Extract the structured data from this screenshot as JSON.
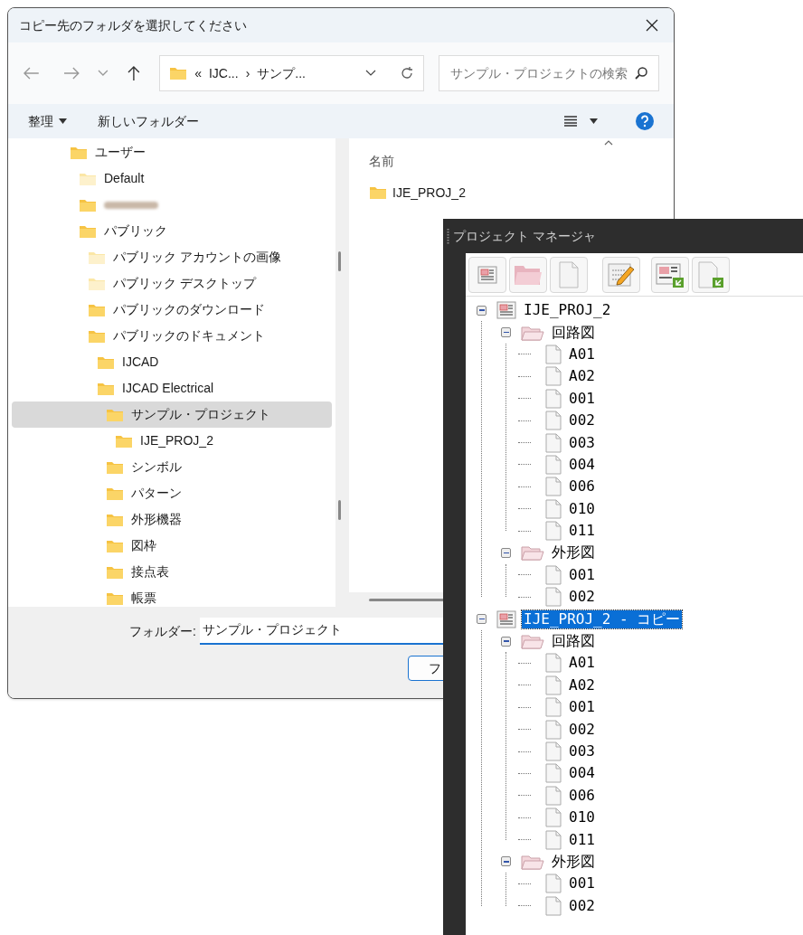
{
  "dialog": {
    "title": "コピー先のフォルダを選択してください",
    "address": {
      "parts": [
        "«",
        "IJC...",
        "›",
        "サンプ..."
      ]
    },
    "search": {
      "placeholder": "サンプル・プロジェクトの検索"
    },
    "toolbar": {
      "organize": "整理",
      "new_folder": "新しいフォルダー"
    },
    "nav_tree": [
      {
        "label": "ユーザー",
        "kind": "folder",
        "selected": false,
        "children": [
          {
            "label": "Default",
            "kind": "empty_folder",
            "selected": false
          },
          {
            "kind": "redacted",
            "selected": false
          },
          {
            "label": "パブリック",
            "kind": "folder",
            "selected": false,
            "children": [
              {
                "label": "パブリック アカウントの画像",
                "kind": "empty_folder",
                "selected": false
              },
              {
                "label": "パブリック デスクトップ",
                "kind": "empty_folder",
                "selected": false
              },
              {
                "label": "パブリックのダウンロード",
                "kind": "folder",
                "selected": false
              },
              {
                "label": "パブリックのドキュメント",
                "kind": "folder",
                "selected": false,
                "children": [
                  {
                    "label": "IJCAD",
                    "kind": "folder",
                    "selected": false
                  },
                  {
                    "label": "IJCAD Electrical",
                    "kind": "folder",
                    "selected": false,
                    "children": [
                      {
                        "label": "サンプル・プロジェクト",
                        "kind": "folder",
                        "selected": true,
                        "children": [
                          {
                            "label": "IJE_PROJ_2",
                            "kind": "folder",
                            "selected": false
                          }
                        ]
                      },
                      {
                        "label": "シンボル",
                        "kind": "folder",
                        "selected": false
                      },
                      {
                        "label": "パターン",
                        "kind": "folder",
                        "selected": false
                      },
                      {
                        "label": "外形機器",
                        "kind": "folder",
                        "selected": false
                      },
                      {
                        "label": "図枠",
                        "kind": "folder",
                        "selected": false
                      },
                      {
                        "label": "接点表",
                        "kind": "folder",
                        "selected": false
                      },
                      {
                        "label": "帳票",
                        "kind": "folder",
                        "selected": false
                      }
                    ]
                  }
                ]
              }
            ]
          }
        ]
      }
    ],
    "file_list": {
      "column": "名前",
      "items": [
        "IJE_PROJ_2"
      ]
    },
    "folder_field": {
      "label": "フォルダー:",
      "value": "サンプル・プロジェクト"
    },
    "button": "フ"
  },
  "project_manager": {
    "title": "プロジェクト マネージャ",
    "tree": [
      {
        "label": "IJE_PROJ_2",
        "kind": "project",
        "selected": false,
        "expanded": true,
        "children": [
          {
            "label": "回路図",
            "kind": "folder",
            "selected": false,
            "expanded": true,
            "children": [
              {
                "label": "A01",
                "kind": "page",
                "selected": false
              },
              {
                "label": "A02",
                "kind": "page",
                "selected": false
              },
              {
                "label": "001",
                "kind": "page",
                "selected": false
              },
              {
                "label": "002",
                "kind": "page",
                "selected": false
              },
              {
                "label": "003",
                "kind": "page",
                "selected": false
              },
              {
                "label": "004",
                "kind": "page",
                "selected": false
              },
              {
                "label": "006",
                "kind": "page",
                "selected": false
              },
              {
                "label": "010",
                "kind": "page",
                "selected": false
              },
              {
                "label": "011",
                "kind": "page",
                "selected": false
              }
            ]
          },
          {
            "label": "外形図",
            "kind": "folder",
            "selected": false,
            "expanded": true,
            "children": [
              {
                "label": "001",
                "kind": "page",
                "selected": false
              },
              {
                "label": "002",
                "kind": "page",
                "selected": false
              }
            ]
          }
        ]
      },
      {
        "label": "IJE_PROJ_2 - コピー",
        "kind": "project",
        "selected": true,
        "expanded": true,
        "children": [
          {
            "label": "回路図",
            "kind": "folder",
            "selected": false,
            "expanded": true,
            "children": [
              {
                "label": "A01",
                "kind": "page",
                "selected": false
              },
              {
                "label": "A02",
                "kind": "page",
                "selected": false
              },
              {
                "label": "001",
                "kind": "page",
                "selected": false
              },
              {
                "label": "002",
                "kind": "page",
                "selected": false
              },
              {
                "label": "003",
                "kind": "page",
                "selected": false
              },
              {
                "label": "004",
                "kind": "page",
                "selected": false
              },
              {
                "label": "006",
                "kind": "page",
                "selected": false
              },
              {
                "label": "010",
                "kind": "page",
                "selected": false
              },
              {
                "label": "011",
                "kind": "page",
                "selected": false
              }
            ]
          },
          {
            "label": "外形図",
            "kind": "folder",
            "selected": false,
            "expanded": true,
            "children": [
              {
                "label": "001",
                "kind": "page",
                "selected": false
              },
              {
                "label": "002",
                "kind": "page",
                "selected": false
              }
            ]
          }
        ]
      }
    ]
  }
}
